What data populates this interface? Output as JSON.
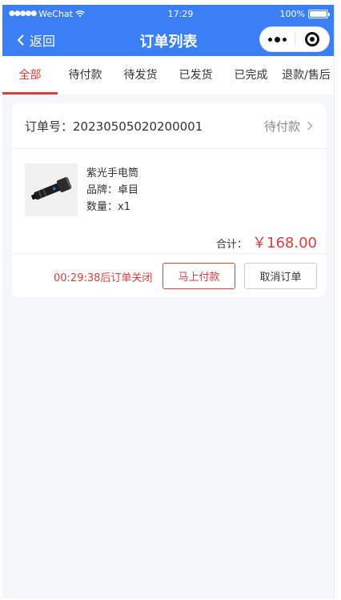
{
  "status_bar": {
    "carrier": "WeChat",
    "time": "17:29",
    "battery": "100%"
  },
  "nav": {
    "back_label": "返回",
    "title": "订单列表"
  },
  "tabs": [
    {
      "label": "全部",
      "active": true
    },
    {
      "label": "待付款",
      "active": false
    },
    {
      "label": "待发货",
      "active": false
    },
    {
      "label": "已发货",
      "active": false
    },
    {
      "label": "已完成",
      "active": false
    },
    {
      "label": "退款/售后",
      "active": false
    }
  ],
  "order": {
    "order_no_label": "订单号：",
    "order_no": "20230505020200001",
    "status": "待付款",
    "product": {
      "name": "紫光手电筒",
      "brand": "品牌：卓目",
      "quantity": "数量：x1",
      "image_icon": "flashlight-icon"
    },
    "total_label": "合计：",
    "total_value": "￥168.00",
    "countdown": "00:29:38后订单关闭",
    "pay_button": "马上付款",
    "cancel_button": "取消订单"
  },
  "colors": {
    "nav_bg": "#3b7ff7",
    "accent_red": "#e23b3b",
    "page_bg": "#f5f6f8"
  }
}
